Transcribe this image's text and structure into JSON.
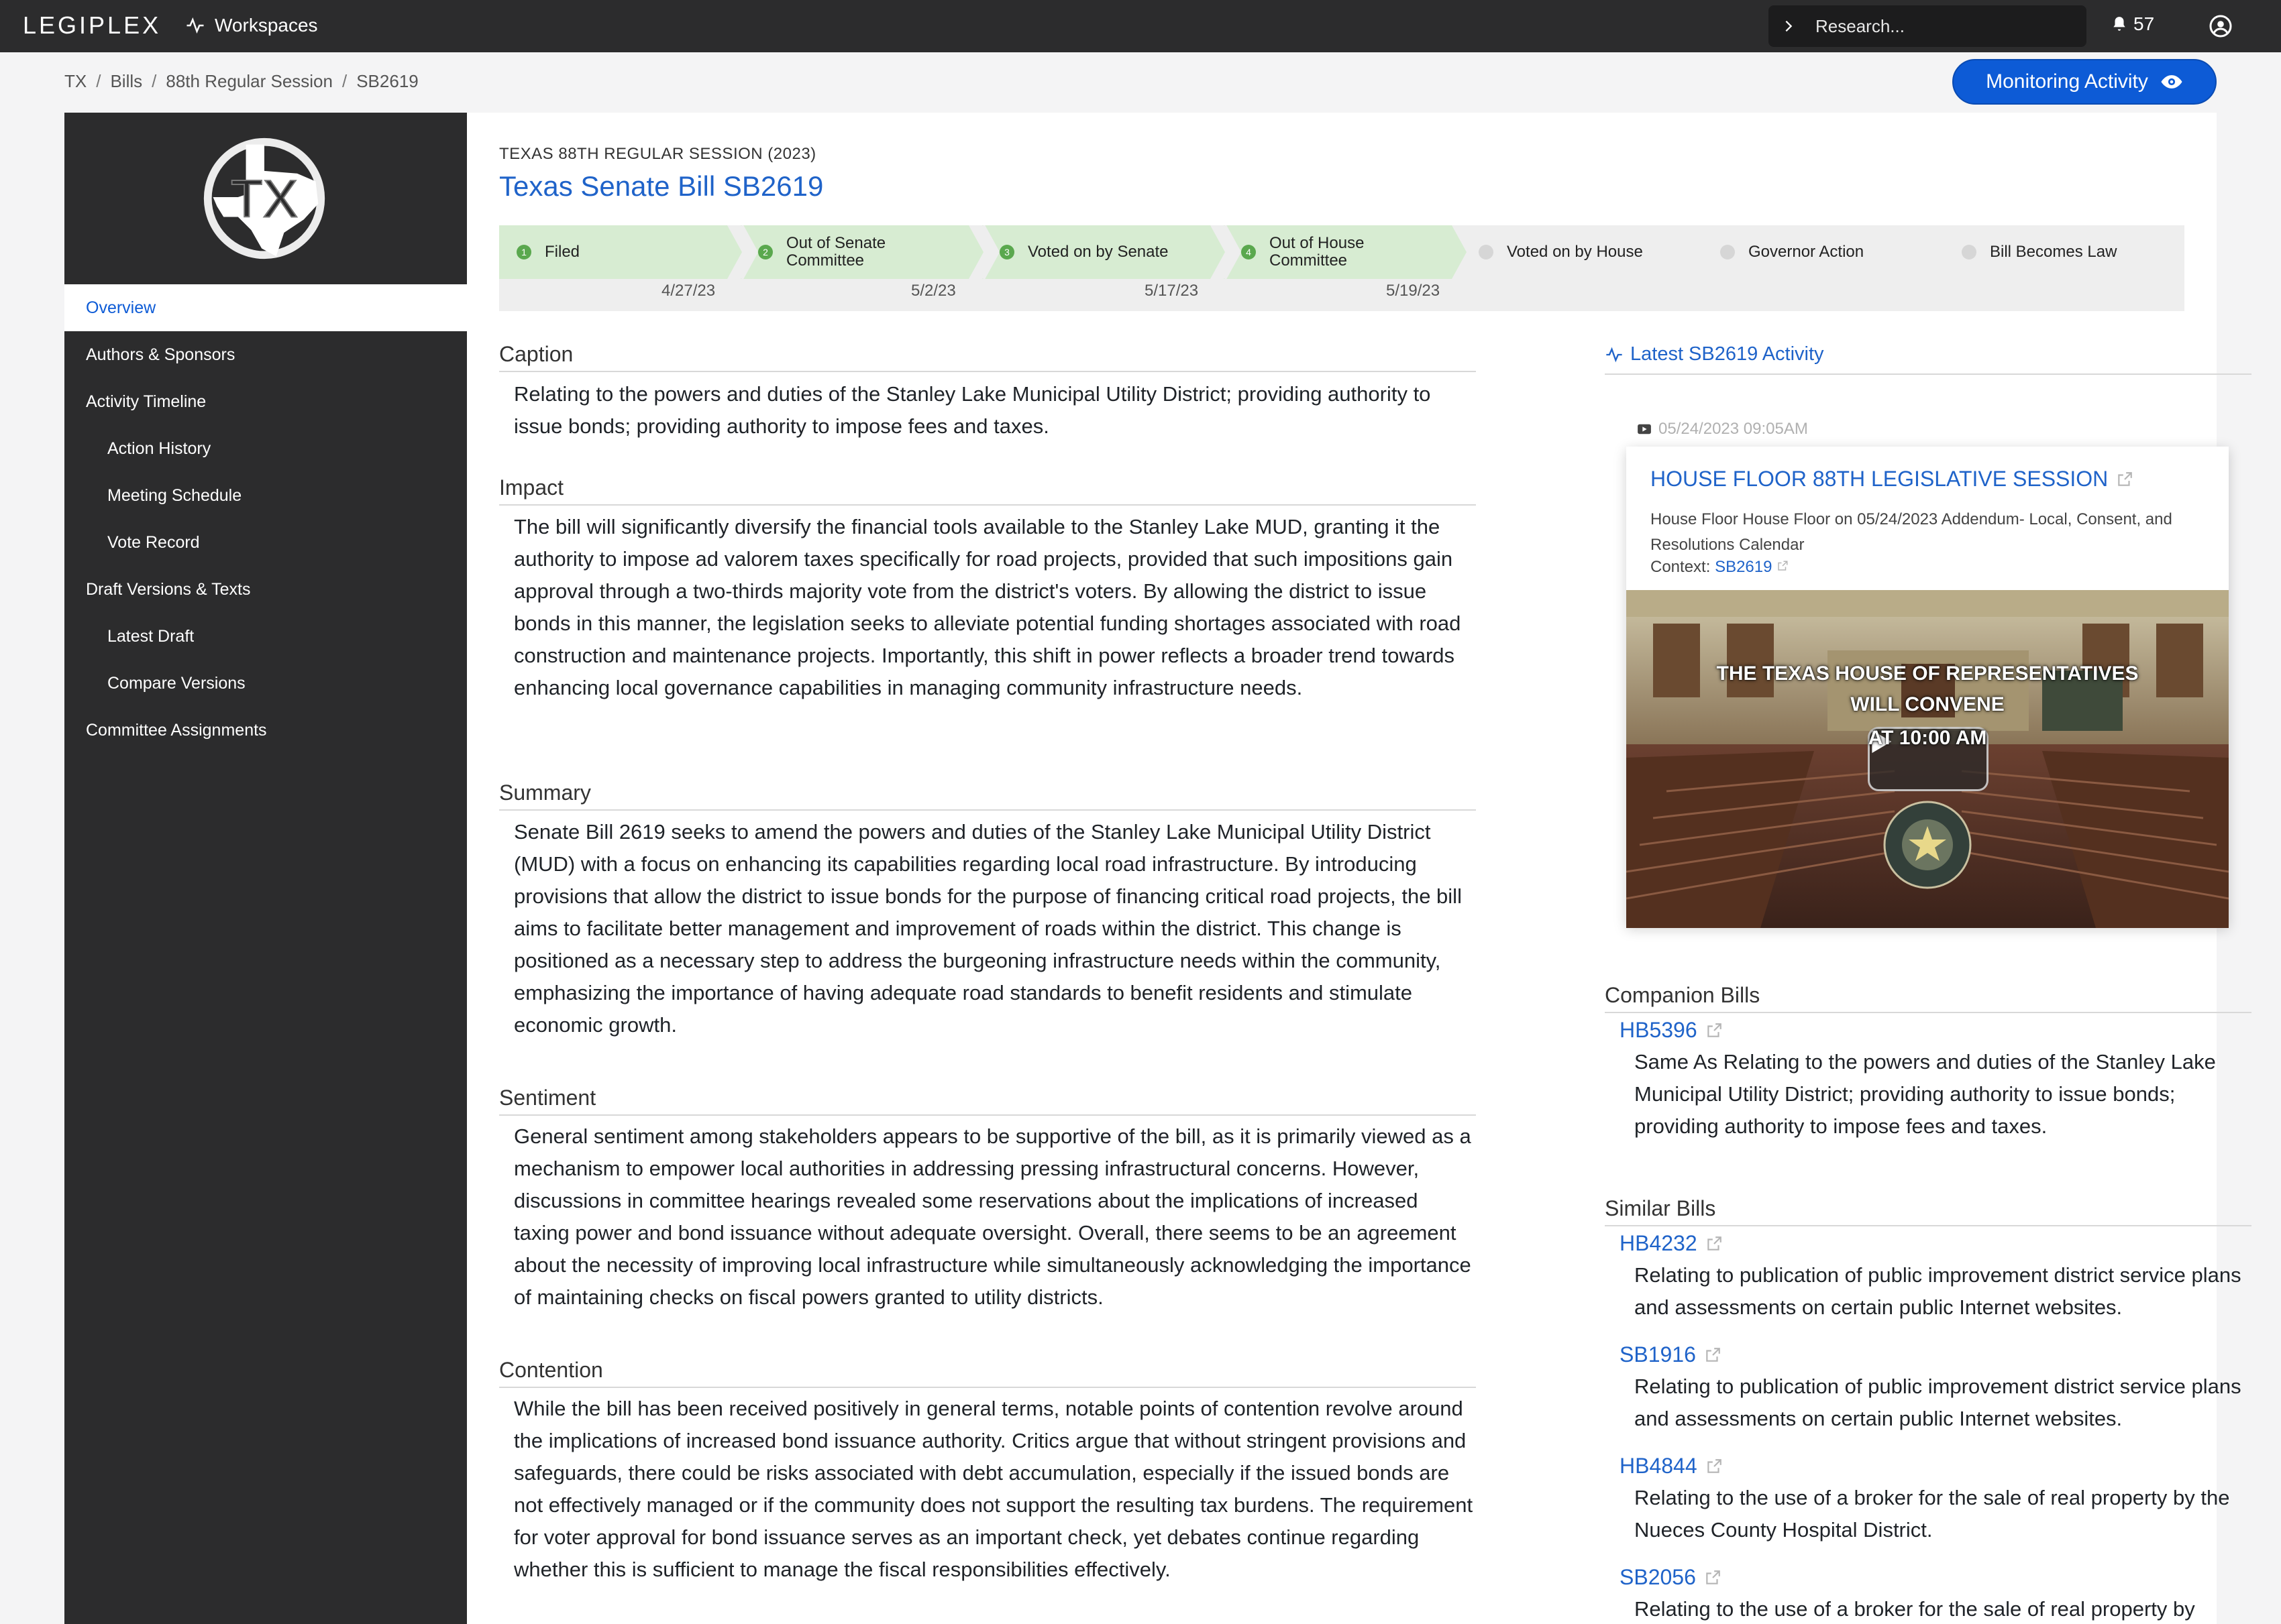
{
  "topbar": {
    "logo": "LEGIPLEX",
    "workspaces_label": "Workspaces",
    "search_placeholder": "Research...",
    "notification_count": "57"
  },
  "breadcrumb": [
    "TX",
    "Bills",
    "88th Regular Session",
    "SB2619"
  ],
  "monitor_button": {
    "label": "Monitoring Activity"
  },
  "sidebar": {
    "seal_text": "TX",
    "items": [
      {
        "label": "Overview",
        "active": true,
        "sub": false
      },
      {
        "label": "Authors & Sponsors",
        "sub": false
      },
      {
        "label": "Activity Timeline",
        "sub": false
      },
      {
        "label": "Action History",
        "sub": true
      },
      {
        "label": "Meeting Schedule",
        "sub": true
      },
      {
        "label": "Vote Record",
        "sub": true
      },
      {
        "label": "Draft Versions & Texts",
        "sub": false
      },
      {
        "label": "Latest Draft",
        "sub": true
      },
      {
        "label": "Compare Versions",
        "sub": true
      },
      {
        "label": "Committee Assignments",
        "sub": false
      }
    ]
  },
  "bill": {
    "session_label": "TEXAS 88TH REGULAR SESSION (2023)",
    "title": "Texas Senate Bill SB2619"
  },
  "tracker": {
    "steps": [
      {
        "num": "1",
        "label": "Filed",
        "date": "4/27/23",
        "status": "done"
      },
      {
        "num": "2",
        "label": "Out of Senate Committee",
        "date": "5/2/23",
        "status": "done"
      },
      {
        "num": "3",
        "label": "Voted on by Senate",
        "date": "5/17/23",
        "status": "done"
      },
      {
        "num": "4",
        "label": "Out of House Committee",
        "date": "5/19/23",
        "status": "done"
      },
      {
        "num": "",
        "label": "Voted on by House",
        "date": "",
        "status": "todo"
      },
      {
        "num": "",
        "label": "Governor Action",
        "date": "",
        "status": "todo"
      },
      {
        "num": "",
        "label": "Bill Becomes Law",
        "date": "",
        "status": "todo"
      }
    ],
    "colors": {
      "done": "#d7ecd2",
      "done_dot": "#5aa84e",
      "todo": "#eeeeee"
    }
  },
  "sections": {
    "caption": {
      "heading": "Caption",
      "text": "Relating to the powers and duties of the Stanley Lake Municipal Utility District; providing authority to issue bonds; providing authority to impose fees and taxes."
    },
    "impact": {
      "heading": "Impact",
      "text": "The bill will significantly diversify the financial tools available to the Stanley Lake MUD, granting it the authority to impose ad valorem taxes specifically for road projects, provided that such impositions gain approval through a two-thirds majority vote from the district's voters. By allowing the district to issue bonds in this manner, the legislation seeks to alleviate potential funding shortages associated with road construction and maintenance projects. Importantly, this shift in power reflects a broader trend towards enhancing local governance capabilities in managing community infrastructure needs."
    },
    "summary": {
      "heading": "Summary",
      "text": "Senate Bill 2619 seeks to amend the powers and duties of the Stanley Lake Municipal Utility District (MUD) with a focus on enhancing its capabilities regarding local road infrastructure. By introducing provisions that allow the district to issue bonds for the purpose of financing critical road projects, the bill aims to facilitate better management and improvement of roads within the district. This change is positioned as a necessary step to address the burgeoning infrastructure needs within the community, emphasizing the importance of having adequate road standards to benefit residents and stimulate economic growth."
    },
    "sentiment": {
      "heading": "Sentiment",
      "text": "General sentiment among stakeholders appears to be supportive of the bill, as it is primarily viewed as a mechanism to empower local authorities in addressing pressing infrastructural concerns. However, discussions in committee hearings revealed some reservations about the implications of increased taxing power and bond issuance without adequate oversight. Overall, there seems to be an agreement about the necessity of improving local infrastructure while simultaneously acknowledging the importance of maintaining checks on fiscal powers granted to utility districts."
    },
    "contention": {
      "heading": "Contention",
      "text": "While the bill has been received positively in general terms, notable points of contention revolve around the implications of increased bond issuance authority. Critics argue that without stringent provisions and safeguards, there could be risks associated with debt accumulation, especially if the issued bonds are not effectively managed or if the community does not support the resulting tax burdens. The requirement for voter approval for bond issuance serves as an important check, yet debates continue regarding whether this is sufficient to manage the fiscal responsibilities effectively."
    }
  },
  "activity": {
    "heading": "Latest SB2619 Activity",
    "timestamp": "05/24/2023 09:05AM",
    "event_title": "HOUSE FLOOR 88TH LEGISLATIVE SESSION",
    "event_desc": "House Floor House Floor on 05/24/2023 Addendum- Local, Consent, and Resolutions Calendar",
    "context_label": "Context:",
    "context_link": "SB2619",
    "video_line1": "THE TEXAS HOUSE OF REPRESENTATIVES",
    "video_line2": "WILL CONVENE",
    "video_line3": "AT 10:00 AM"
  },
  "companion": {
    "heading": "Companion Bills",
    "items": [
      {
        "id": "HB5396",
        "text": "Same As Relating to the powers and duties of the Stanley Lake Municipal Utility District; providing authority to issue bonds; providing authority to impose fees and taxes."
      }
    ]
  },
  "similar": {
    "heading": "Similar Bills",
    "items": [
      {
        "id": "HB4232",
        "text": "Relating to publication of public improvement district service plans and assessments on certain public Internet websites."
      },
      {
        "id": "SB1916",
        "text": "Relating to publication of public improvement district service plans and assessments on certain public Internet websites."
      },
      {
        "id": "HB4844",
        "text": "Relating to the use of a broker for the sale of real property by the Nueces County Hospital District."
      },
      {
        "id": "SB2056",
        "text": "Relating to the use of a broker for the sale of real property by"
      }
    ]
  },
  "colors": {
    "accent": "#0d5bd6",
    "link": "#1f63c9",
    "sidebar": "#2c2c2d"
  }
}
